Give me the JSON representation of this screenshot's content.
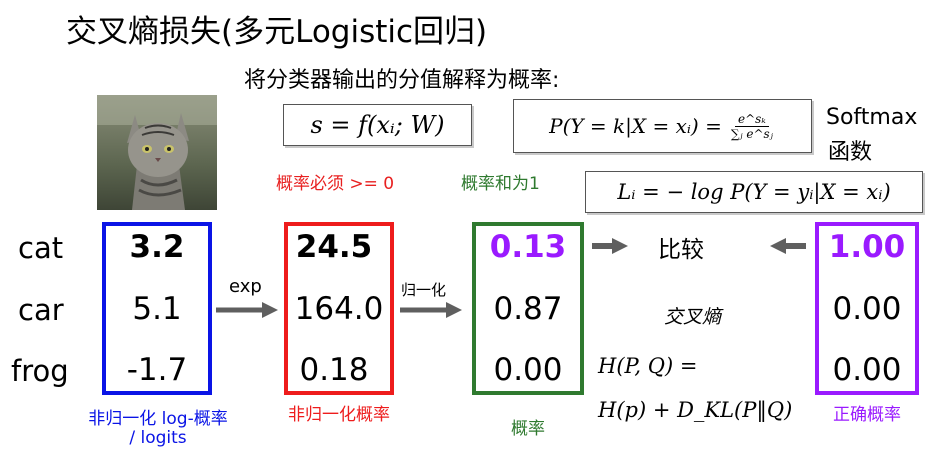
{
  "title": "交叉熵损失(多元Logistic回归)",
  "subtitle": "将分类器输出的分值解释为概率:",
  "formulas": {
    "score": "s = f(xᵢ; W)",
    "softmax_lhs": "P(Y = k|X = xᵢ) =",
    "softmax_num": "e^sₖ",
    "softmax_den": "∑ⱼ e^sⱼ",
    "softmax_label_1": "Softmax",
    "softmax_label_2": "函数",
    "loss": "Lᵢ = − log P(Y = yᵢ|X = xᵢ)",
    "cross_entropy_label": "交叉熵",
    "cross_entropy_line1": "H(P, Q) =",
    "cross_entropy_line2": "H(p) + D_KL(P‖Q)"
  },
  "notes": {
    "must_be_nonneg": "概率必须 >= 0",
    "sum_to_one": "概率和为1",
    "exp": "exp",
    "normalize": "归一化",
    "compare": "比较"
  },
  "classes": [
    "cat",
    "car",
    "frog"
  ],
  "columns": {
    "logits": {
      "values": [
        "3.2",
        "5.1",
        "-1.7"
      ],
      "caption_1": "非归一化 log-概率",
      "caption_2": "/ logits",
      "color": "#0a14e6"
    },
    "unnormalized": {
      "values": [
        "24.5",
        "164.0",
        "0.18"
      ],
      "caption": "非归一化概率",
      "color": "#ee1c1c"
    },
    "probs": {
      "values": [
        "0.13",
        "0.87",
        "0.00"
      ],
      "caption": "概率",
      "color": "#2f7a2f"
    },
    "correct": {
      "values": [
        "1.00",
        "0.00",
        "0.00"
      ],
      "caption": "正确概率",
      "color": "#9a1aff"
    }
  },
  "colors": {
    "arrow": "#5f5f5f",
    "score_note": "#e82020",
    "sum_note": "#2f7a2f"
  },
  "image": {
    "subject": "cat-photo"
  }
}
